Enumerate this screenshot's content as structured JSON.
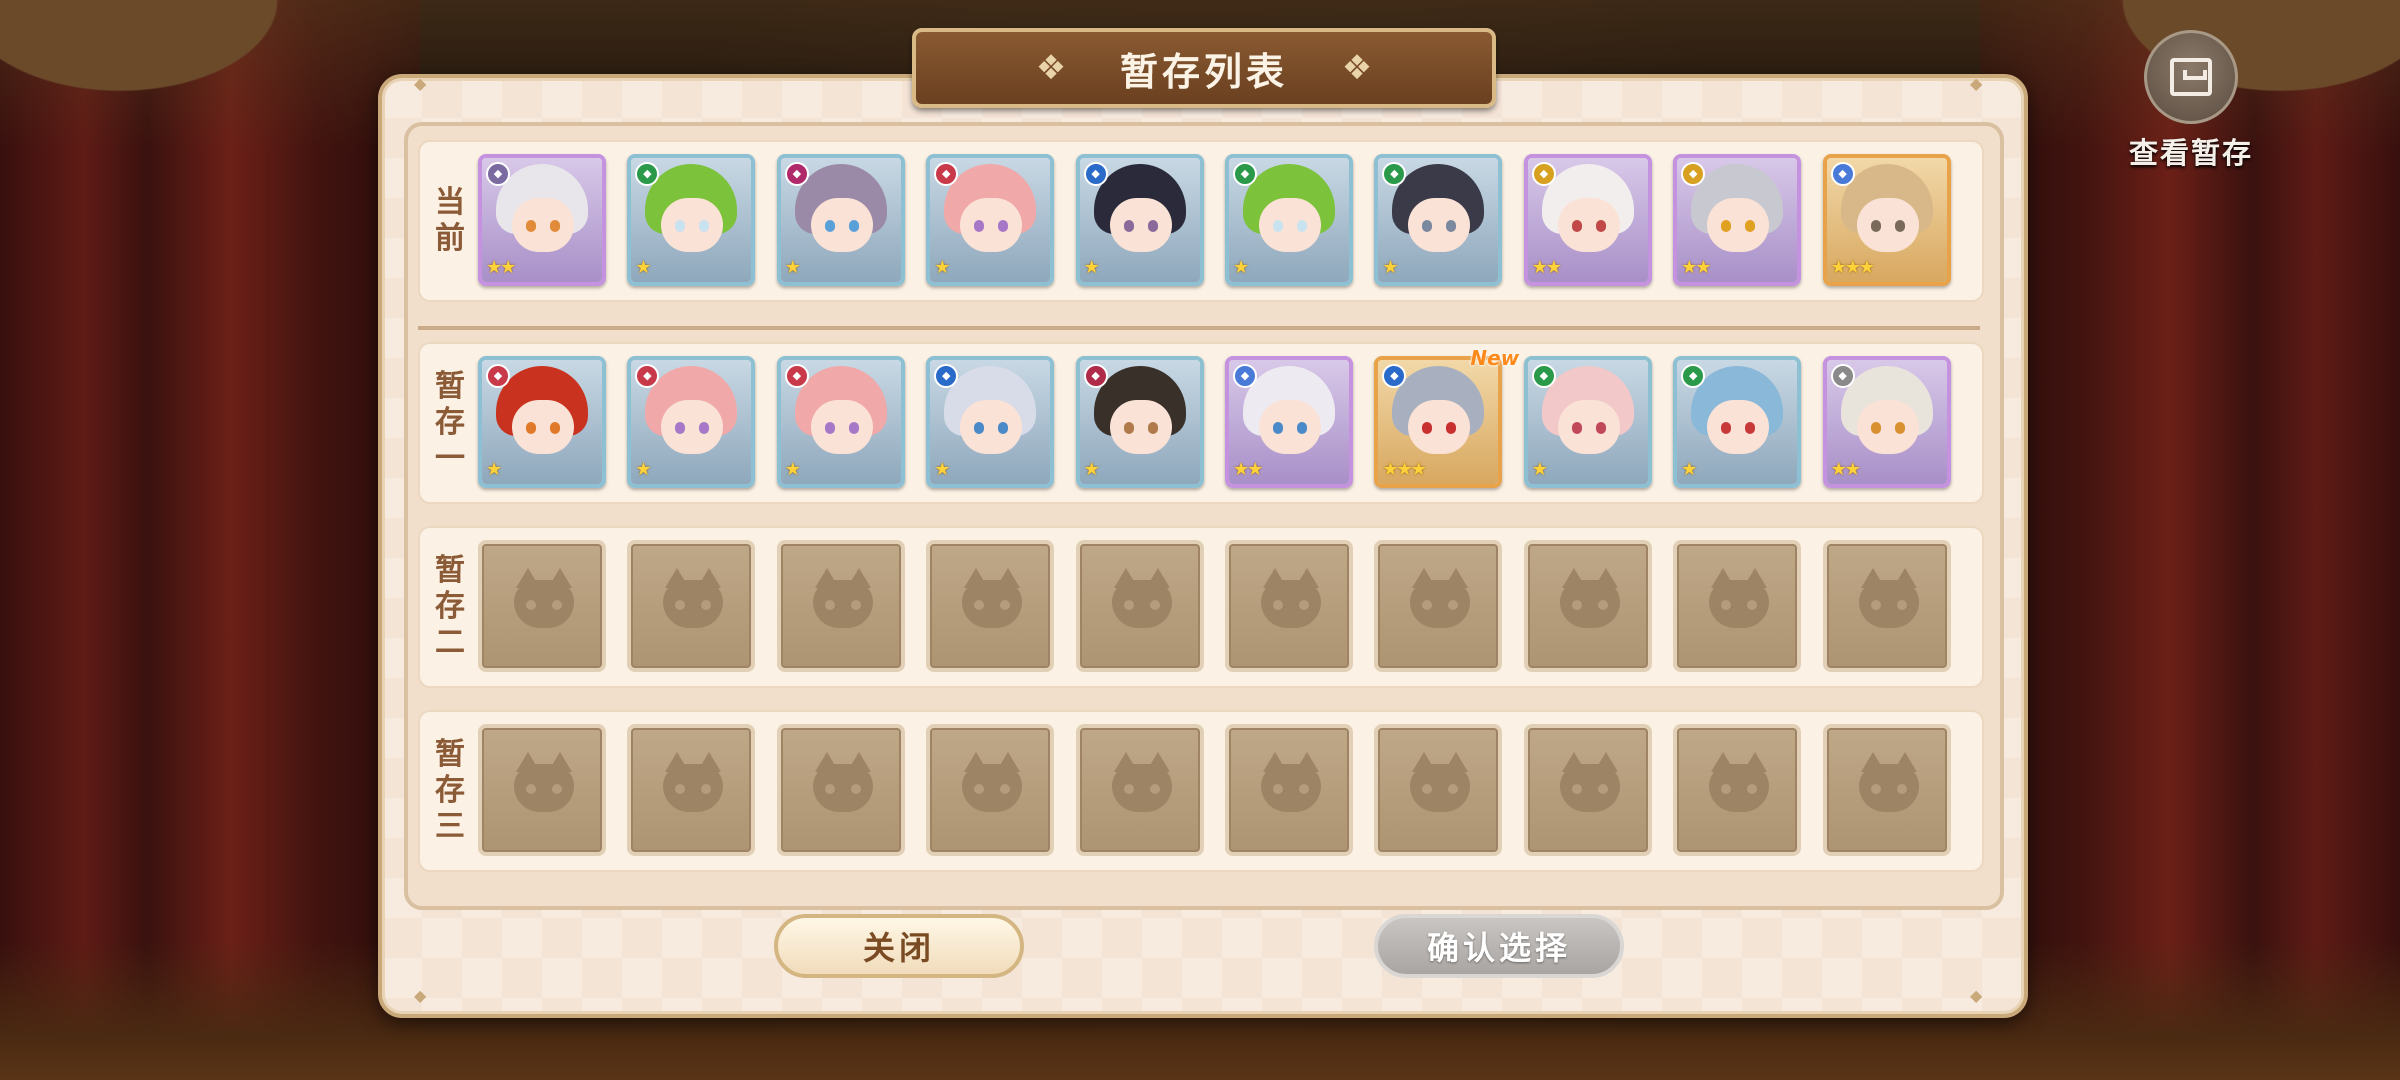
{
  "header": {
    "title": "暂存列表",
    "view_stash_label": "查看暂存",
    "view_stash_icon": "stash-box-icon"
  },
  "rows": [
    {
      "label": "当前",
      "cards": [
        {
          "hair": "#e8e6ea",
          "eyes": "#e08a3a",
          "cls": "#7a6aa0",
          "stars": "★★",
          "rarity": "purple"
        },
        {
          "hair": "#7cc23a",
          "eyes": "#c9e2f0",
          "cls": "#2a9a4a",
          "stars": "★",
          "rarity": "blue"
        },
        {
          "hair": "#9a8aa8",
          "eyes": "#5aa0d8",
          "cls": "#b02a6a",
          "stars": "★",
          "rarity": "blue"
        },
        {
          "hair": "#f0a8a8",
          "eyes": "#a878c8",
          "cls": "#c83a4a",
          "stars": "★",
          "rarity": "blue"
        },
        {
          "hair": "#2a2a3a",
          "eyes": "#8a6a9a",
          "cls": "#2a6ac8",
          "stars": "★",
          "rarity": "blue"
        },
        {
          "hair": "#7cc23a",
          "eyes": "#c9e2f0",
          "cls": "#2a9a4a",
          "stars": "★",
          "rarity": "blue"
        },
        {
          "hair": "#3a3a48",
          "eyes": "#7a88a0",
          "cls": "#2a9a4a",
          "stars": "★",
          "rarity": "blue"
        },
        {
          "hair": "#f2eeee",
          "eyes": "#c04848",
          "cls": "#d8a020",
          "stars": "★★",
          "rarity": "purple"
        },
        {
          "hair": "#c8c8d0",
          "eyes": "#e0a020",
          "cls": "#d8a020",
          "stars": "★★",
          "rarity": "purple"
        },
        {
          "hair": "#d8b888",
          "eyes": "#7a6a5a",
          "cls": "#4a7ad8",
          "stars": "★★★",
          "rarity": "gold"
        }
      ]
    },
    {
      "label": "暂存一",
      "cards": [
        {
          "hair": "#c8321e",
          "eyes": "#e07a2a",
          "cls": "#c83a4a",
          "stars": "★",
          "rarity": "blue"
        },
        {
          "hair": "#f0a8a8",
          "eyes": "#a878c8",
          "cls": "#c83a4a",
          "stars": "★",
          "rarity": "blue"
        },
        {
          "hair": "#f0a8a8",
          "eyes": "#a878c8",
          "cls": "#c83a4a",
          "stars": "★",
          "rarity": "blue"
        },
        {
          "hair": "#d8dce8",
          "eyes": "#4a8ac8",
          "cls": "#2a6ac8",
          "stars": "★",
          "rarity": "blue"
        },
        {
          "hair": "#3a302a",
          "eyes": "#b07a4a",
          "cls": "#b02a4a",
          "stars": "★",
          "rarity": "blue"
        },
        {
          "hair": "#eeeaf2",
          "eyes": "#4a8ac8",
          "cls": "#4a7ad8",
          "stars": "★★",
          "rarity": "purple"
        },
        {
          "hair": "#a8b0c0",
          "eyes": "#c83030",
          "cls": "#2a6ac8",
          "stars": "★★★",
          "rarity": "gold",
          "is_new": true
        },
        {
          "hair": "#f2c8c8",
          "eyes": "#c04858",
          "cls": "#2a9a4a",
          "stars": "★",
          "rarity": "blue"
        },
        {
          "hair": "#8ab8d8",
          "eyes": "#c83a3a",
          "cls": "#2a9a4a",
          "stars": "★",
          "rarity": "blue"
        },
        {
          "hair": "#e8e4dc",
          "eyes": "#d89030",
          "cls": "#8a8a8a",
          "stars": "★★",
          "rarity": "purple"
        }
      ]
    },
    {
      "label": "暂存二",
      "cards": []
    },
    {
      "label": "暂存三",
      "cards": []
    }
  ],
  "new_badge": "New",
  "buttons": {
    "close": "关闭",
    "confirm": "确认选择"
  }
}
